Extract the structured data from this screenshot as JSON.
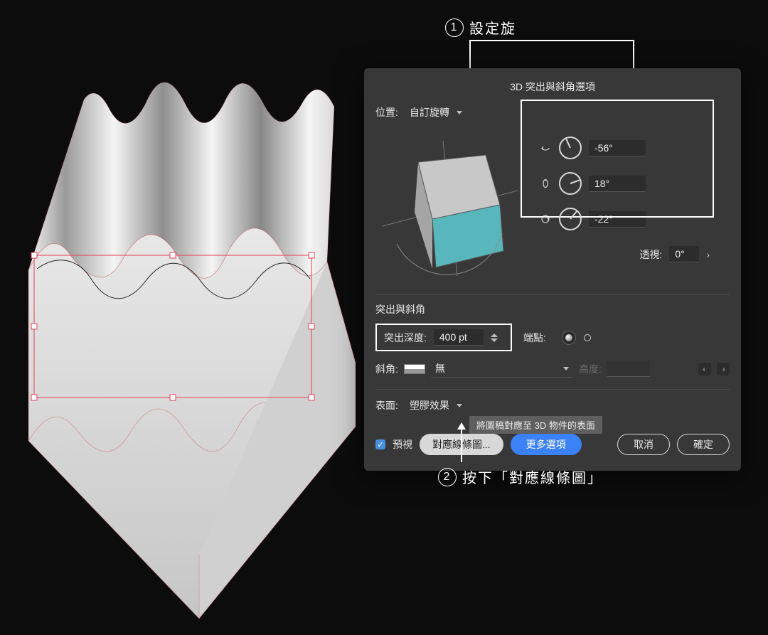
{
  "annotations": {
    "one_num": "1",
    "one_text": "設定旋",
    "two_num": "2",
    "two_text": "按下「對應線條圖」"
  },
  "dialog": {
    "title": "3D 突出與斜角選項",
    "position_label": "位置:",
    "position_value": "自訂旋轉",
    "rotation": {
      "x": "-56°",
      "y": "18°",
      "z": "-22°"
    },
    "perspective_label": "透視:",
    "perspective_value": "0°",
    "extrude_section": "突出與斜角",
    "depth_label": "突出深度:",
    "depth_value": "400 pt",
    "cap_label": "端點:",
    "bevel_label": "斜角:",
    "bevel_value": "無",
    "height_label": "高度:",
    "surface_label": "表面:",
    "surface_value": "塑膠效果",
    "preview_label": "預視",
    "map_art_btn": "對應線條圖...",
    "more_options_btn": "更多選項",
    "cancel_btn": "取消",
    "ok_btn": "確定",
    "tooltip": "將圖稿對應至 3D 物件的表面"
  }
}
